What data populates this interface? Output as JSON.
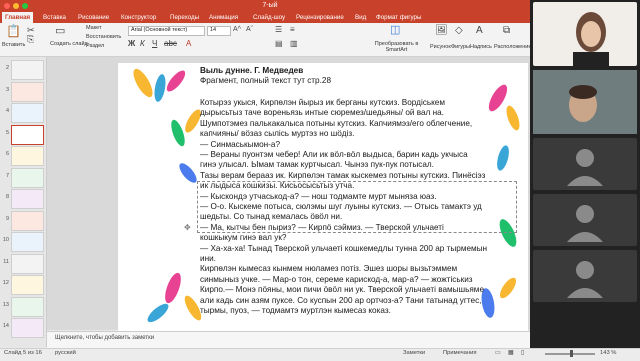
{
  "window": {
    "title": "7-ый"
  },
  "tabs": [
    "Главная",
    "Вставка",
    "Рисование",
    "Конструктор",
    "Переходы",
    "Анимация",
    "Слайд-шоу",
    "Рецензирование",
    "Вид",
    "Формат фигуры"
  ],
  "ribbon": {
    "paste_label": "Вставить",
    "create_slide_label": "Создать слайд",
    "maket_label": "Макет",
    "restore_label": "Восстановить",
    "section_label": "Раздел",
    "font_name": "Arial (Основной текст)",
    "font_size": "14",
    "convert_label": "Преобразовать в SmartArt",
    "picture_label": "Рисунок",
    "shapes_label": "Фигуры",
    "textbox_label": "Надпись",
    "arrange_label": "Расположение"
  },
  "thumbnails": [
    {
      "num": "2"
    },
    {
      "num": "3"
    },
    {
      "num": "4"
    },
    {
      "num": "5"
    },
    {
      "num": "6"
    },
    {
      "num": "7"
    },
    {
      "num": "8"
    },
    {
      "num": "9"
    },
    {
      "num": "10"
    },
    {
      "num": "11"
    },
    {
      "num": "12"
    },
    {
      "num": "13"
    },
    {
      "num": "14"
    }
  ],
  "slide": {
    "title": "Выль дунне. Г. Медведев",
    "subtitle": "Фрагмент, полный текст тут стр.28",
    "lines": [
      "Котырэз укыся, Кирпөлэн йырыз ик берганы кутскиз. Вордiськем",
      "дырысьтыз таче вореньязь интые сюремез/шедьяны/ ой вал на.",
      "Шумпотэмез палькакалыса потыны кутскиз. Капчиямэз/его облегчение,",
      "капчияны/ вöзаз сылiсь муртэз но шöдiз.",
      "— Синмаськымон-а?",
      "— Вераны пуонтэм чебер! Али ик вöл-вöл выдыса, барин кадь укчыса",
      "гинэ улысал. Ымам тамак куртчысал. Чынэз пук-пук потысал.",
      "Тазы верам берааз ик. Кирпөлэн тамак кыскемез потыны кутскиз. Пинёсiэз",
      "ик лыдыса кошкизы. Кисьосысьтыз утча.",
      "— Кыскондэ утчаськод-а? — нош тодмамте мурт мыняза юаз.",
      "— О-о. Кыскеме потыса, сюлэмы шуг луыны кутскиз. — Отысь тамактэ уд",
      "шедьты. Со тынад кемалась öвöл ни.",
      "— Ма, кытчы бен пыриз? — Кирпö сэймиз. — Тверской ульчаетi",
      "кошкыкум гинэ вал ук?",
      "— Ха-ха-ха! Тынад Тверской ульчаетi кошкемедлы тунна 200 ар тырмемын",
      "ини.",
      "Кирпөлэн кымесаз кынмем нюламез потiз. Эшез шоры вызьтэммем",
      "синмыныз учке. — Мар-о тон, сереме карискод-а, мар-а? — жожтiськиз",
      "Кирпо.— Монэ пöяны, мои пичи öвöл ни ук. Тверской ульчаетi вамышьяме",
      "али кадь син азям пуксе. Со куспын 200 ар ортчоз-а? Тани татынад угтес,",
      "тырмы, пуоз, — тодмамтэ муртлэн кымесаз коказ."
    ]
  },
  "notes": {
    "placeholder": "Щелкните, чтобы добавить заметки"
  },
  "status": {
    "slide_info": "Слайд 5 из 16",
    "language": "русский",
    "notes_btn": "Заметки",
    "comments_btn": "Примечания",
    "zoom": "143 %"
  },
  "video": {
    "participants": 5
  },
  "colors": {
    "accent": "#c8412a",
    "underline": "#c0392b"
  }
}
